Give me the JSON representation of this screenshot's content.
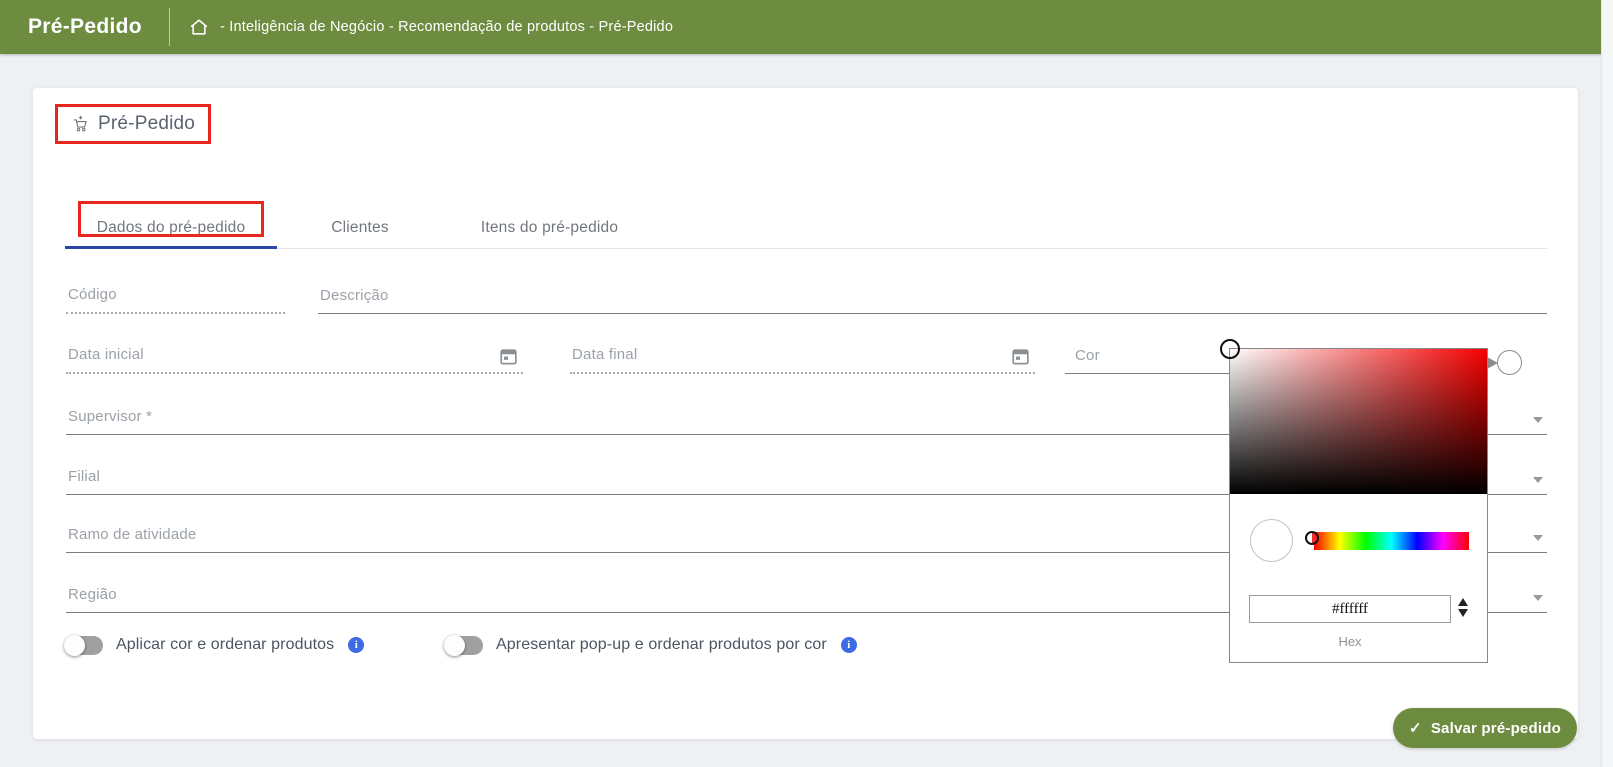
{
  "header": {
    "title": "Pré-Pedido",
    "breadcrumb": "- Inteligência de Negócio - Recomendação de produtos - Pré-Pedido"
  },
  "card": {
    "title": "Pré-Pedido",
    "tabs": [
      {
        "label": "Dados do pré-pedido",
        "active": true
      },
      {
        "label": "Clientes",
        "active": false
      },
      {
        "label": "Itens do pré-pedido",
        "active": false
      }
    ],
    "fields": {
      "codigo": "Código",
      "descricao": "Descrição",
      "data_inicial": "Data inicial",
      "data_final": "Data final",
      "cor": "Cor",
      "supervisor": "Supervisor *",
      "filial": "Filial",
      "ramo_de_atividade": "Ramo de atividade",
      "regiao": "Região"
    },
    "toggles": [
      {
        "label": "Aplicar cor e ordenar produtos",
        "state": "off"
      },
      {
        "label": "Apresentar pop-up e ordenar produtos por cor",
        "state": "off"
      }
    ],
    "save_button": {
      "label": "Salvar pré-pedido"
    }
  },
  "color_picker": {
    "hex_value": "#ffffff",
    "hex_label": "Hex",
    "selected_color": "#ffffff"
  },
  "icons": {
    "check_glyph": "✓",
    "info_glyph": "i"
  },
  "colors": {
    "header_green": "#6d8c40",
    "tab_accent_blue": "#2b46a5",
    "annotation_red": "#e8251f",
    "info_blue": "#3d6be4",
    "page_bg": "#eef0f4"
  }
}
